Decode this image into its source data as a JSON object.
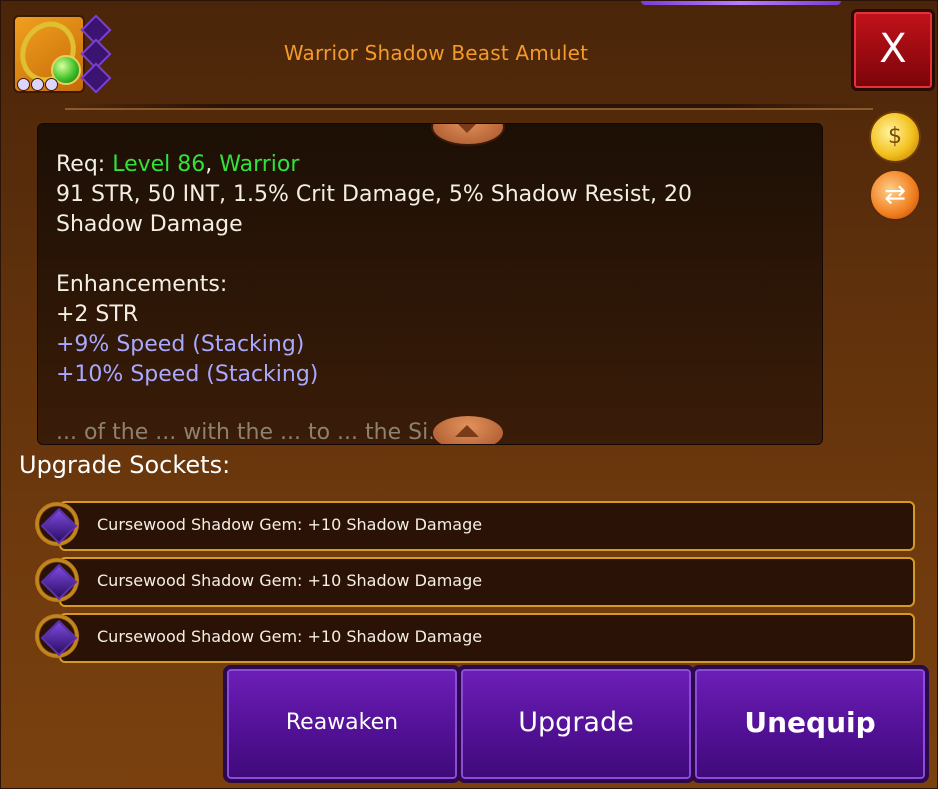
{
  "header": {
    "title": "Warrior Shadow Beast Amulet",
    "close_label": "X"
  },
  "description": {
    "req_label": "Req: ",
    "req_level": "Level 86",
    "req_sep": ", ",
    "req_class": "Warrior",
    "stats_line1": "91 STR, 50 INT, 1.5% Crit Damage, 5% Shadow Resist, 20",
    "stats_line2": "Shadow Damage",
    "enhancements_label": "Enhancements:",
    "enhancement_1": "+2 STR",
    "enhancement_2": "+9% Speed (Stacking)",
    "enhancement_3": "+10% Speed (Stacking)",
    "overflow_hint": "... of the ... with the ... to ... the Si... Be..."
  },
  "sockets": {
    "label": "Upgrade Sockets:",
    "items": [
      {
        "text": "Cursewood Shadow Gem: +10 Shadow Damage"
      },
      {
        "text": "Cursewood Shadow Gem: +10 Shadow Damage"
      },
      {
        "text": "Cursewood Shadow Gem: +10 Shadow Damage"
      }
    ]
  },
  "actions": {
    "reawaken": "Reawaken",
    "upgrade": "Upgrade",
    "unequip": "Unequip"
  },
  "icons": {
    "item": "amulet-icon",
    "gold": "gold-bag-icon",
    "swap": "swap-icon",
    "gem": "shadow-gem-icon"
  },
  "colors": {
    "title": "#f39a2a",
    "requirement": "#34e03a",
    "enhancement_bonus": "#a9a8ff",
    "button": "#551299",
    "close_button": "#c2121a"
  }
}
